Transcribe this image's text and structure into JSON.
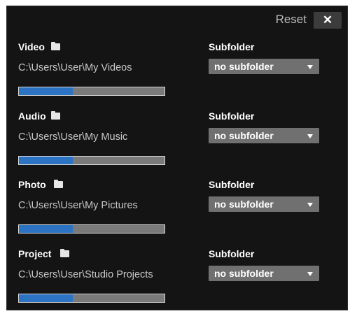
{
  "toolbar": {
    "reset_label": "Reset",
    "close_label": "✕"
  },
  "subfolder_label": "Subfolder",
  "sections": [
    {
      "title": "Video",
      "path": "C:\\Users\\User\\My Videos",
      "subfolder": "no subfolder",
      "progress_fraction": 0.37
    },
    {
      "title": "Audio",
      "path": "C:\\Users\\User\\My Music",
      "subfolder": "no subfolder",
      "progress_fraction": 0.37
    },
    {
      "title": "Photo",
      "path": "C:\\Users\\User\\My Pictures",
      "subfolder": "no subfolder",
      "progress_fraction": 0.37
    },
    {
      "title": "Project",
      "path": "C:\\Users\\User\\Studio Projects",
      "subfolder": "no subfolder",
      "progress_fraction": 0.37
    }
  ],
  "colors": {
    "panel_bg": "#141414",
    "progress_fill": "#2d73c4",
    "progress_track": "#7a7a7a",
    "select_bg": "#707070"
  }
}
